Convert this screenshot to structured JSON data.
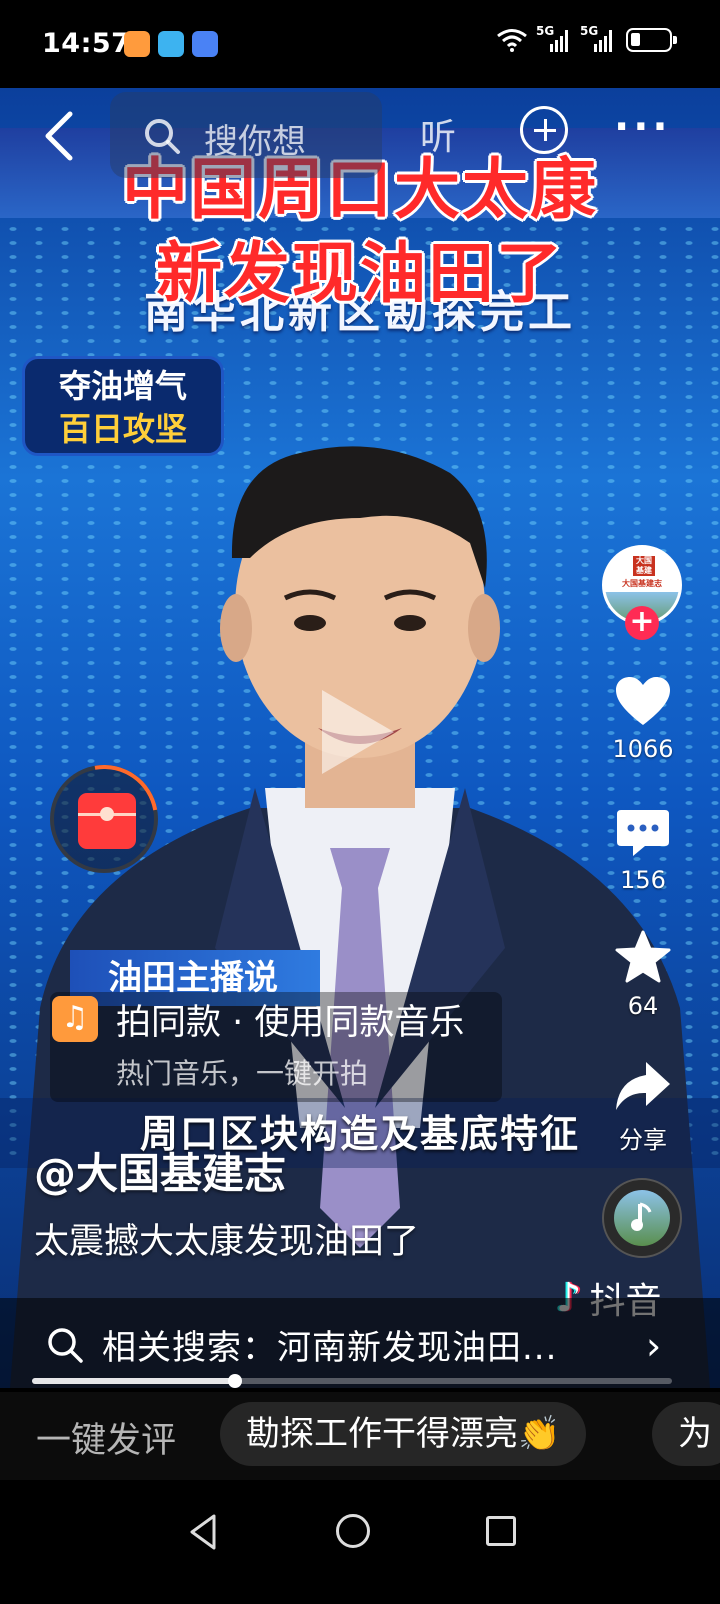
{
  "status_bar": {
    "time": "14:57",
    "network_1": "5G",
    "network_2": "5G",
    "app_icons": [
      "heart-app-icon",
      "book-app-icon",
      "message-app-icon"
    ]
  },
  "top_nav": {
    "search_placeholder": "搜你想",
    "listen_label": "听"
  },
  "video": {
    "headline_line1": "中国周口大太康",
    "headline_line2": "新发现油田了",
    "subhead": "南华北新区勘探完工",
    "badge_line1": "夺油增气",
    "badge_line2": "百日攻坚",
    "ticker": "油田主播说",
    "caption": "周口区块构造及基底特征"
  },
  "right_rail": {
    "avatar_logo": "大国基建",
    "avatar_name": "大国基建志",
    "like_count": "1066",
    "comment_count": "156",
    "favorite_count": "64",
    "share_label": "分享"
  },
  "music": {
    "title": "拍同款 · 使用同款音乐",
    "subtitle": "热门音乐，一键开拍"
  },
  "post": {
    "author": "@大国基建志",
    "description": "太震撼大太康发现油田了"
  },
  "brand": {
    "name": "抖音"
  },
  "related_search": {
    "text": "相关搜索：河南新发现油田..."
  },
  "progress": {
    "fraction": 0.317
  },
  "comment_bar": {
    "label": "一键发评",
    "chips": [
      "勘探工作干得漂亮👏",
      "为"
    ]
  },
  "colors": {
    "headline_red": "#ff2a2a",
    "badge_yellow": "#ffcf3a",
    "follow_pink": "#ff2b54",
    "music_orange": "#ff9a3c"
  }
}
